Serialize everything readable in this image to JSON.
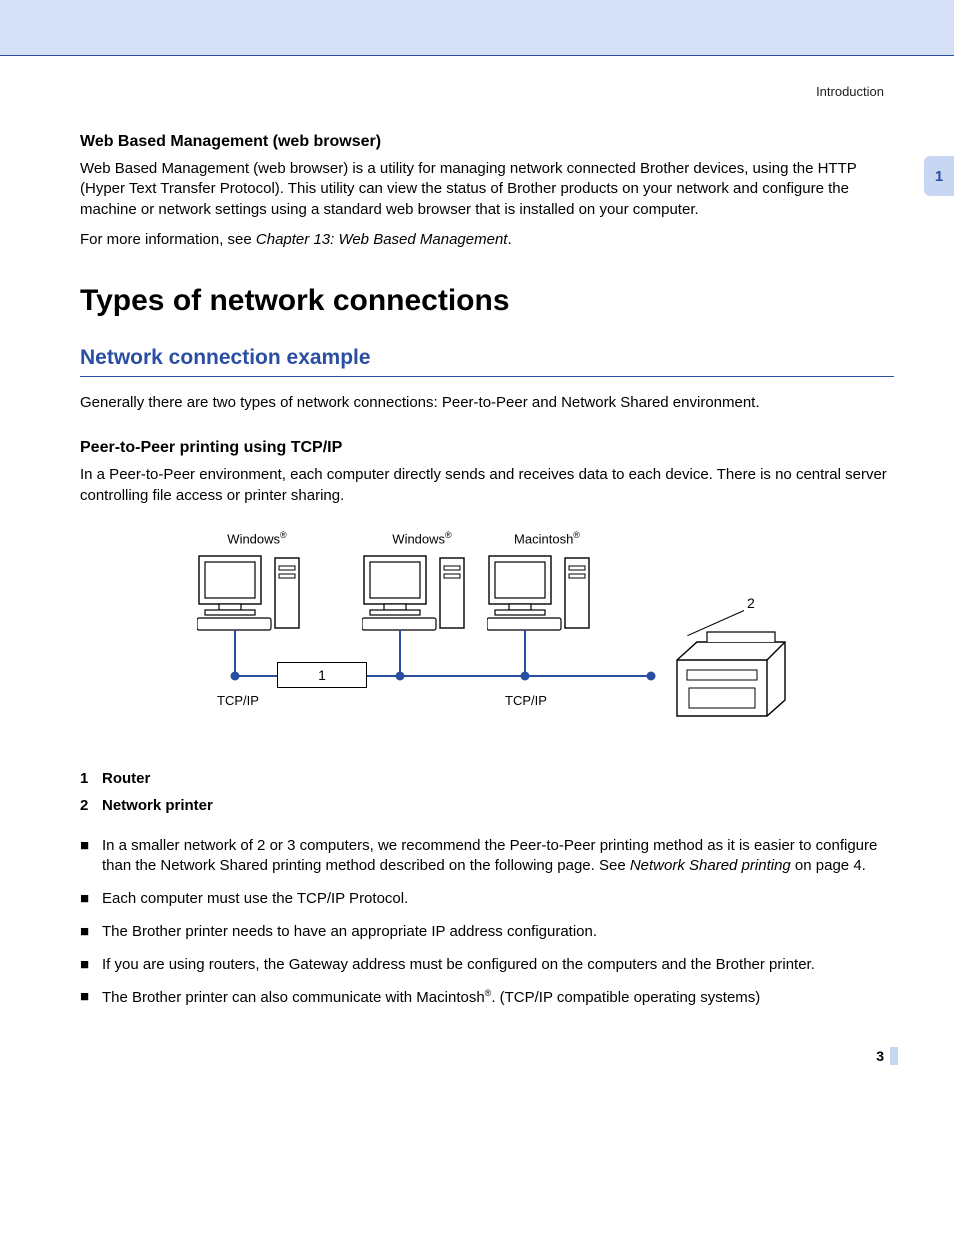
{
  "running_head": "Introduction",
  "chapter_tab": "1",
  "sections": {
    "wbm_heading": "Web Based Management (web browser)",
    "wbm_para": "Web Based Management (web browser) is a utility for managing network connected Brother devices, using the HTTP (Hyper Text Transfer Protocol). This utility can view the status of Brother products on your network and configure the machine or network settings using a standard web browser that is installed on your computer.",
    "wbm_more_pre": "For more information, see ",
    "wbm_more_ref": "Chapter 13: Web Based Management",
    "wbm_more_post": ".",
    "types_heading": "Types of network connections",
    "nce_heading": "Network connection example",
    "nce_para": "Generally there are two types of network connections: Peer-to-Peer and Network Shared environment.",
    "p2p_heading": "Peer-to-Peer printing using TCP/IP",
    "p2p_para": "In a Peer-to-Peer environment, each computer directly sends and receives data to each device. There is no central server controlling file access or printer sharing."
  },
  "diagram": {
    "os_labels": [
      "Windows",
      "Windows",
      "Macintosh"
    ],
    "reg_mark": "®",
    "router_num": "1",
    "printer_num": "2",
    "tcpip_label": "TCP/IP"
  },
  "legend": [
    {
      "num": "1",
      "label": "Router"
    },
    {
      "num": "2",
      "label": "Network printer"
    }
  ],
  "bullets": {
    "b1_pre": "In a smaller network of 2 or 3 computers, we recommend the Peer-to-Peer printing method as it is easier to configure than the Network Shared printing method described on the following page. See ",
    "b1_ref": "Network Shared printing",
    "b1_post": " on page 4.",
    "b2": "Each computer must use the TCP/IP Protocol.",
    "b3": "The Brother printer needs to have an appropriate IP address configuration.",
    "b4": "If you are using routers, the Gateway address must be configured on the computers and the Brother printer.",
    "b5_pre": "The Brother printer can also communicate with Macintosh",
    "b5_sup": "®",
    "b5_post": ". (TCP/IP compatible operating systems)"
  },
  "page_number": "3",
  "bullet_glyph": "■"
}
